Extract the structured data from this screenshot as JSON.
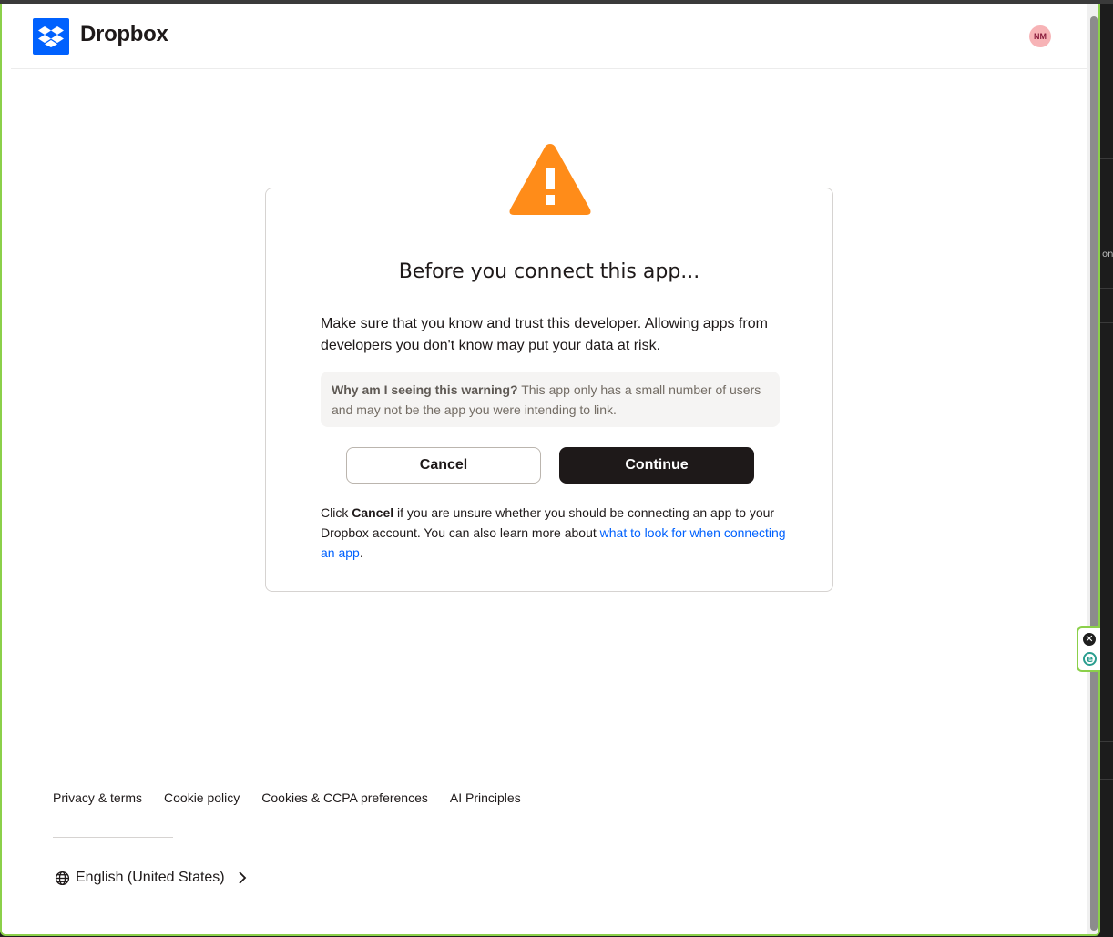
{
  "header": {
    "brand": "Dropbox",
    "avatar_initials": "NM",
    "logo_icon": "dropbox-logo-icon",
    "brand_color": "#0061fe"
  },
  "dialog": {
    "icon": "warning-triangle-icon",
    "icon_color": "#ff8c19",
    "title": "Before you connect this app...",
    "lead": "Make sure that you know and trust this developer. Allowing apps from developers you don't know may put your data at risk.",
    "info_question": "Why am I seeing this warning?",
    "info_text": " This app only has a small number of users and may not be the app you were intending to link.",
    "cancel_label": "Cancel",
    "continue_label": "Continue",
    "note_prefix": "Click ",
    "note_bold": "Cancel",
    "note_middle": " if you are unsure whether you should be connecting an app to your Dropbox account. You can also learn more about ",
    "note_link": "what to look for when connecting an app",
    "note_suffix": ".",
    "link_color": "#0061fe"
  },
  "footer": {
    "links": [
      "Privacy & terms",
      "Cookie policy",
      "Cookies & CCPA preferences",
      "AI Principles"
    ],
    "language": "English (United States)"
  },
  "extension": {
    "close_glyph": "✕",
    "badge_glyph": "e"
  },
  "right_edge_fragment": "on"
}
